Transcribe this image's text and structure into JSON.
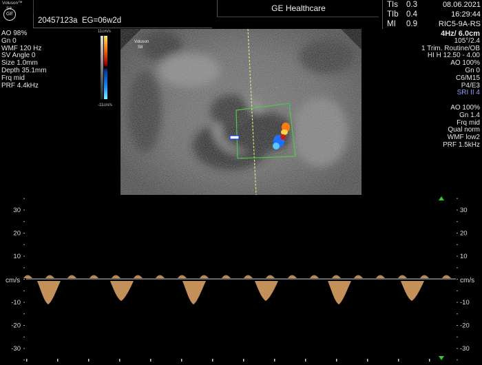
{
  "brand": {
    "name": "Voluson™",
    "model": "S8",
    "logo_text": "GE"
  },
  "patient": {
    "id": "20457123a",
    "exam": "EG=06w2d"
  },
  "hospital": "GE Healthcare",
  "indices": [
    {
      "label": "TIs",
      "value": "0.3"
    },
    {
      "label": "TIb",
      "value": "0.4"
    },
    {
      "label": "MI",
      "value": "0.9"
    }
  ],
  "date": "08.06.2021",
  "time": "16:29:44",
  "probe": "RIC5-9A-RS",
  "left_params": [
    "AO 98%",
    "Gn  0",
    "WMF 120 Hz",
    "SV Angle  0",
    "Size  1.0mm",
    "Depth 35.1mm",
    "Frq mid",
    "PRF  4.4kHz"
  ],
  "right_params": [
    "4Hz/ 6.0cm",
    "105°/2.4",
    "1 Trim. Routine/OB",
    "HI H  12.50 - 4.00",
    "AO 100%",
    "Gn  0",
    "C6/M15",
    "P4/E3",
    "SRI II 4",
    "",
    "AO 100%",
    "Gn  1.4",
    "Frq mid",
    "Qual norm",
    "WMF low2",
    "PRF  1.5kHz"
  ],
  "colorbar": {
    "top": "11cm/s",
    "bottom": "-11cm/s"
  },
  "image_label": {
    "brand": "Voluson",
    "model": "S8"
  },
  "doppler": {
    "unit": "cm/s",
    "ticks": [
      30,
      20,
      10,
      -10,
      -20,
      -30
    ],
    "colors": {
      "trace": "#e6a968",
      "baseline": "#cfcfcf",
      "marker": "#34c934"
    }
  }
}
